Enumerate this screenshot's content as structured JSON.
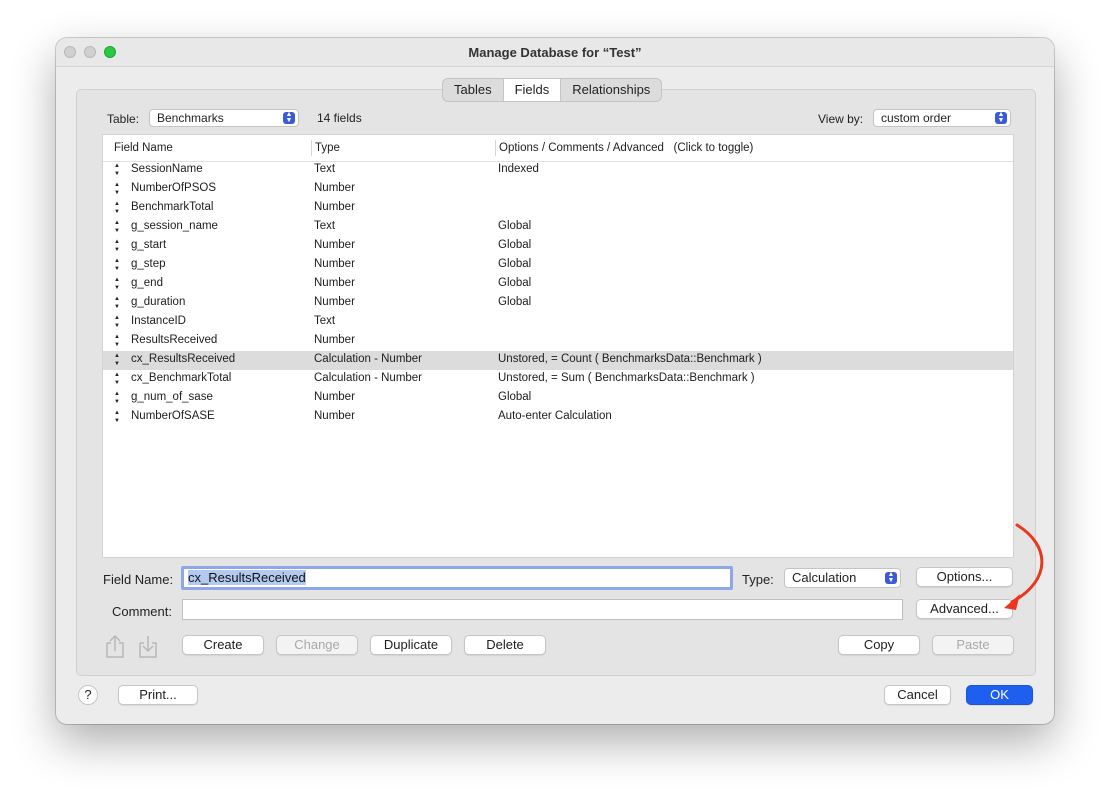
{
  "window": {
    "title": "Manage Database for “Test”"
  },
  "tabs": [
    "Tables",
    "Fields",
    "Relationships"
  ],
  "table_selector": {
    "label": "Table:",
    "value": "Benchmarks",
    "count": "14 fields"
  },
  "view_by": {
    "label": "View by:",
    "value": "custom order"
  },
  "columns": [
    "Field Name",
    "Type",
    "Options / Comments / Advanced   (Click to toggle)"
  ],
  "rows": [
    {
      "name": "SessionName",
      "type": "Text",
      "options": "Indexed"
    },
    {
      "name": "NumberOfPSOS",
      "type": "Number",
      "options": ""
    },
    {
      "name": "BenchmarkTotal",
      "type": "Number",
      "options": ""
    },
    {
      "name": "g_session_name",
      "type": "Text",
      "options": "Global"
    },
    {
      "name": "g_start",
      "type": "Number",
      "options": "Global"
    },
    {
      "name": "g_step",
      "type": "Number",
      "options": "Global"
    },
    {
      "name": "g_end",
      "type": "Number",
      "options": "Global"
    },
    {
      "name": "g_duration",
      "type": "Number",
      "options": "Global"
    },
    {
      "name": "InstanceID",
      "type": "Text",
      "options": ""
    },
    {
      "name": "ResultsReceived",
      "type": "Number",
      "options": ""
    },
    {
      "name": "cx_ResultsReceived",
      "type": "Calculation - Number",
      "options": "Unstored, = Count ( BenchmarksData::Benchmark )"
    },
    {
      "name": "cx_BenchmarkTotal",
      "type": "Calculation - Number",
      "options": "Unstored, = Sum ( BenchmarksData::Benchmark )"
    },
    {
      "name": "g_num_of_sase",
      "type": "Number",
      "options": "Global"
    },
    {
      "name": "NumberOfSASE",
      "type": "Number",
      "options": "Auto-enter Calculation"
    }
  ],
  "selected_row_index": 10,
  "editor": {
    "field_name_label": "Field Name:",
    "field_name_value": "cx_ResultsReceived",
    "type_label": "Type:",
    "type_value": "Calculation",
    "options_button": "Options...",
    "comment_label": "Comment:",
    "comment_value": "",
    "advanced_button": "Advanced..."
  },
  "actions": {
    "create": "Create",
    "change": "Change",
    "duplicate": "Duplicate",
    "delete": "Delete",
    "copy": "Copy",
    "paste": "Paste"
  },
  "footer": {
    "help": "?",
    "print": "Print...",
    "cancel": "Cancel",
    "ok": "OK"
  },
  "colors": {
    "accent": "#1f5ff0",
    "annotation_arrow": "#e8391e",
    "selected_row": "#dcdcdc"
  }
}
